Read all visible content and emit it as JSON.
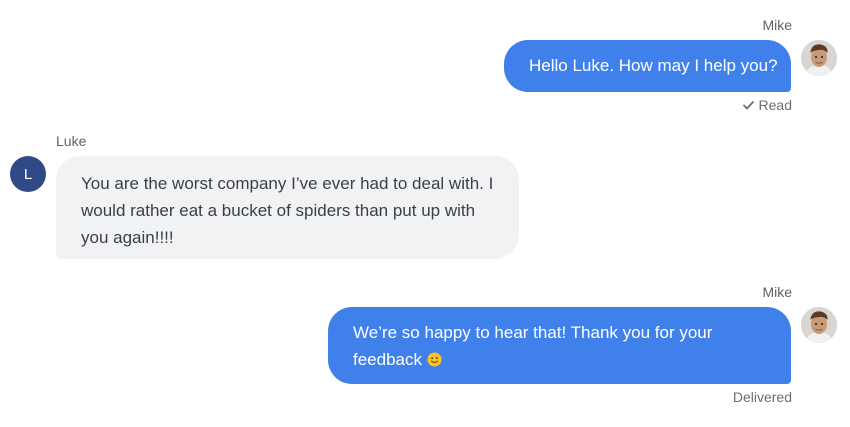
{
  "messages": [
    {
      "sender": "Mike",
      "direction": "outgoing",
      "text": "Hello Luke. How may I help you?",
      "status": "Read",
      "status_icon": "check-icon"
    },
    {
      "sender": "Luke",
      "direction": "incoming",
      "avatar_initial": "L",
      "lines": [
        "You are the worst company I’ve ever had to deal with. I",
        "would rather eat a bucket of spiders than put up with",
        "you again!!!!"
      ]
    },
    {
      "sender": "Mike",
      "direction": "outgoing",
      "lines": [
        "We’re so happy to hear that! Thank you for your",
        "feedback"
      ],
      "emoji": "slightly-smiling-face-emoji",
      "status": "Delivered"
    }
  ],
  "colors": {
    "outgoing_bubble": "#3f80ea",
    "incoming_bubble": "#f1f2f4",
    "luke_avatar": "#2f4a86"
  }
}
